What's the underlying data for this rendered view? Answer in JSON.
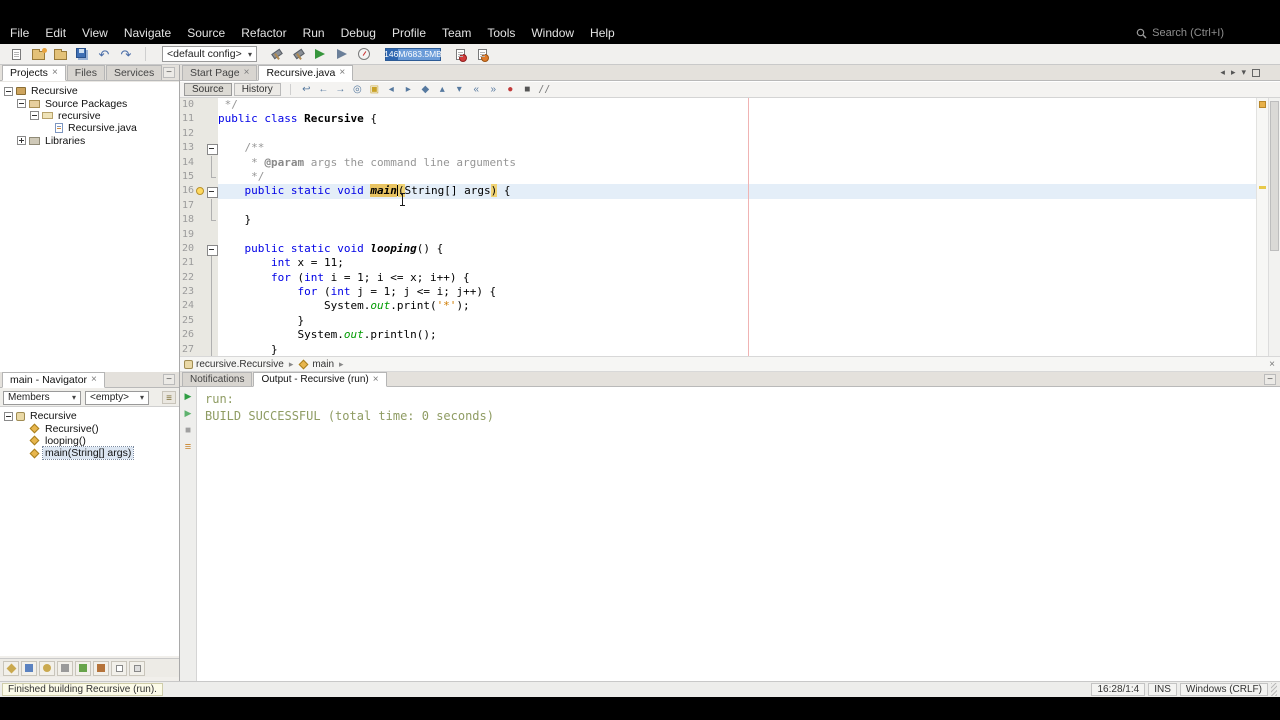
{
  "menu_bar": {
    "items": [
      "File",
      "Edit",
      "View",
      "Navigate",
      "Source",
      "Refactor",
      "Run",
      "Debug",
      "Profile",
      "Team",
      "Tools",
      "Window",
      "Help"
    ],
    "search_placeholder": "Search (Ctrl+I)"
  },
  "toolbar": {
    "config_label": "<default config>",
    "memory_label": "146M/683.5MB"
  },
  "icons": {
    "close": "×",
    "dropdown_arrow": "▾",
    "minimize": "−",
    "scroll_left": "◂",
    "scroll_right": "▸",
    "tab_list": "▾",
    "crumb_sep": "▸",
    "undo": "↶",
    "redo": "↷"
  },
  "projects_panel": {
    "tabs": [
      {
        "label": "Projects",
        "active": true,
        "closable": true
      },
      {
        "label": "Files",
        "active": false,
        "closable": false
      },
      {
        "label": "Services",
        "active": false,
        "closable": false
      }
    ],
    "tree": [
      {
        "label": "Recursive",
        "level": 0,
        "icon": "project",
        "handle": "minus",
        "selected": false
      },
      {
        "label": "Source Packages",
        "level": 1,
        "icon": "source-root",
        "handle": "minus",
        "selected": false
      },
      {
        "label": "recursive",
        "level": 2,
        "icon": "package",
        "handle": "minus",
        "selected": false
      },
      {
        "label": "Recursive.java",
        "level": 3,
        "icon": "java-file",
        "handle": "none",
        "selected": false
      },
      {
        "label": "Libraries",
        "level": 1,
        "icon": "libraries",
        "handle": "plus",
        "selected": false
      }
    ]
  },
  "editor": {
    "tabs": [
      {
        "label": "Start Page",
        "active": false,
        "closable": true
      },
      {
        "label": "Recursive.java",
        "active": true,
        "closable": true
      }
    ],
    "toolbar": {
      "source_label": "Source",
      "history_label": "History",
      "icons": [
        {
          "name": "last-edit-location",
          "glyph": "↩"
        },
        {
          "name": "back",
          "glyph": "←"
        },
        {
          "name": "forward",
          "glyph": "→"
        },
        {
          "name": "find-selection",
          "glyph": "◎"
        },
        {
          "name": "highlight-occurrences",
          "glyph": "▣"
        },
        {
          "name": "previous-bookmark",
          "glyph": "◂"
        },
        {
          "name": "next-bookmark",
          "glyph": "▸"
        },
        {
          "name": "toggle-bookmark",
          "glyph": "◆"
        },
        {
          "name": "previous-occurrence",
          "glyph": "▴"
        },
        {
          "name": "next-occurrence",
          "glyph": "▾"
        },
        {
          "name": "shift-line-left",
          "glyph": "«"
        },
        {
          "name": "shift-line-right",
          "glyph": "»"
        },
        {
          "name": "start-macro-recording",
          "glyph": "●"
        },
        {
          "name": "stop-macro-recording",
          "glyph": "■"
        },
        {
          "name": "toggle-comment",
          "glyph": "//"
        }
      ]
    },
    "breadcrumb": [
      {
        "label": "recursive.Recursive",
        "icon": "class"
      },
      {
        "label": "main",
        "icon": "method"
      }
    ],
    "lines": [
      {
        "n": "10",
        "fold": "none",
        "tokens": [
          {
            "t": "cmt",
            "s": " */"
          }
        ]
      },
      {
        "n": "11",
        "fold": "none",
        "tokens": [
          {
            "t": "k w",
            "s": ""
          },
          {
            "t": "kw",
            "s": "public"
          },
          {
            "t": "plain",
            "s": " "
          },
          {
            "t": "kw",
            "s": "class"
          },
          {
            "t": "plain",
            "s": " "
          },
          {
            "t": "bold",
            "s": "Recursive"
          },
          {
            "t": "plain",
            "s": " {"
          }
        ]
      },
      {
        "n": "12",
        "fold": "none",
        "tokens": []
      },
      {
        "n": "13",
        "fold": "start",
        "tokens": [
          {
            "t": "cmt",
            "s": "    /**"
          }
        ]
      },
      {
        "n": "14",
        "fold": "mid",
        "tokens": [
          {
            "t": "cmt",
            "s": "     * "
          },
          {
            "t": "cmtb",
            "s": "@param"
          },
          {
            "t": "cmt",
            "s": " args the command line arguments"
          }
        ]
      },
      {
        "n": "15",
        "fold": "end",
        "tokens": [
          {
            "t": "cmt",
            "s": "     */"
          }
        ]
      },
      {
        "n": "16",
        "fold": "start",
        "current": true,
        "glyph": "hint",
        "tokens": [
          {
            "t": "plain",
            "s": "    "
          },
          {
            "t": "kw",
            "s": "public"
          },
          {
            "t": "plain",
            "s": " "
          },
          {
            "t": "kw",
            "s": "static"
          },
          {
            "t": "plain",
            "s": " "
          },
          {
            "t": "kw",
            "s": "void"
          },
          {
            "t": "plain",
            "s": " "
          },
          {
            "t": "mainhl",
            "s": "main"
          },
          {
            "t": "caret",
            "s": ""
          },
          {
            "t": "parenhl",
            "s": "("
          },
          {
            "t": "plain",
            "s": "String[] args"
          },
          {
            "t": "parenhl",
            "s": ")"
          },
          {
            "t": "plain",
            "s": " {"
          }
        ]
      },
      {
        "n": "17",
        "fold": "mid",
        "tokens": []
      },
      {
        "n": "18",
        "fold": "end",
        "tokens": [
          {
            "t": "plain",
            "s": "    }"
          }
        ]
      },
      {
        "n": "19",
        "fold": "none",
        "tokens": []
      },
      {
        "n": "20",
        "fold": "start",
        "tokens": [
          {
            "t": "plain",
            "s": "    "
          },
          {
            "t": "kw",
            "s": "public"
          },
          {
            "t": "plain",
            "s": " "
          },
          {
            "t": "kw",
            "s": "static"
          },
          {
            "t": "plain",
            "s": " "
          },
          {
            "t": "kw",
            "s": "void"
          },
          {
            "t": "plain",
            "s": " "
          },
          {
            "t": "mdecl",
            "s": "looping"
          },
          {
            "t": "plain",
            "s": "() {"
          }
        ]
      },
      {
        "n": "21",
        "fold": "mid",
        "tokens": [
          {
            "t": "plain",
            "s": "        "
          },
          {
            "t": "kw",
            "s": "int"
          },
          {
            "t": "plain",
            "s": " x = 11;"
          }
        ]
      },
      {
        "n": "22",
        "fold": "mid",
        "tokens": [
          {
            "t": "plain",
            "s": "        "
          },
          {
            "t": "kw",
            "s": "for"
          },
          {
            "t": "plain",
            "s": " ("
          },
          {
            "t": "kw",
            "s": "int"
          },
          {
            "t": "plain",
            "s": " i = 1; i <= x; i++) {"
          }
        ]
      },
      {
        "n": "23",
        "fold": "mid",
        "tokens": [
          {
            "t": "plain",
            "s": "            "
          },
          {
            "t": "kw",
            "s": "for"
          },
          {
            "t": "plain",
            "s": " ("
          },
          {
            "t": "kw",
            "s": "int"
          },
          {
            "t": "plain",
            "s": " j = 1; j <= i; j++) {"
          }
        ]
      },
      {
        "n": "24",
        "fold": "mid",
        "tokens": [
          {
            "t": "plain",
            "s": "                System."
          },
          {
            "t": "field",
            "s": "out"
          },
          {
            "t": "plain",
            "s": ".print("
          },
          {
            "t": "str",
            "s": "'*'"
          },
          {
            "t": "plain",
            "s": ");"
          }
        ]
      },
      {
        "n": "25",
        "fold": "mid",
        "tokens": [
          {
            "t": "plain",
            "s": "            }"
          }
        ]
      },
      {
        "n": "26",
        "fold": "mid",
        "tokens": [
          {
            "t": "plain",
            "s": "            System."
          },
          {
            "t": "field",
            "s": "out"
          },
          {
            "t": "plain",
            "s": ".println();"
          }
        ]
      },
      {
        "n": "27",
        "fold": "mid",
        "tokens": [
          {
            "t": "plain",
            "s": "        }"
          }
        ]
      }
    ]
  },
  "navigator": {
    "tab_label": "main - Navigator",
    "members_filter": "Members",
    "empty_filter": "<empty>",
    "tree": [
      {
        "label": "Recursive",
        "level": 0,
        "icon": "class",
        "handle": "minus",
        "selected": false
      },
      {
        "label": "Recursive()",
        "level": 1,
        "icon": "constructor",
        "handle": "none",
        "selected": false
      },
      {
        "label": "looping()",
        "level": 1,
        "icon": "method",
        "handle": "none",
        "selected": false
      },
      {
        "label": "main(String[] args)",
        "level": 1,
        "icon": "method",
        "handle": "none",
        "selected": true
      }
    ],
    "filter_buttons": [
      "show-inherited-members",
      "show-fields",
      "show-static-members",
      "show-non-public-members",
      "sort-by-name",
      "sort-by-source",
      "expand-all",
      "collapse-all"
    ]
  },
  "output": {
    "tabs": [
      {
        "label": "Notifications",
        "active": false,
        "closable": false
      },
      {
        "label": "Output - Recursive (run)",
        "active": true,
        "closable": true
      }
    ],
    "strip_icons": [
      {
        "name": "rerun",
        "glyph": "▶"
      },
      {
        "name": "rerun-with-different-parameters",
        "glyph": "▶"
      },
      {
        "name": "stop-build",
        "glyph": "■"
      },
      {
        "name": "ant-settings",
        "glyph": "≡"
      }
    ],
    "lines": [
      "run:",
      "BUILD SUCCESSFUL (total time: 0 seconds)"
    ]
  },
  "status_bar": {
    "message": "Finished building Recursive (run).",
    "caret_position": "16:28/1:4",
    "insert_mode": "INS",
    "line_ending": "Windows (CRLF)"
  },
  "colors": {
    "keyword": "#0000e6",
    "comment": "#969696",
    "string": "#ce7b00",
    "static_field": "#009b00",
    "current_line_bg": "#e4eef8",
    "brace_match_bg": "#e9c462",
    "output_text": "#8f9c63",
    "right_margin": "#f0b3b3",
    "memory_gauge": "#2e66b0"
  }
}
